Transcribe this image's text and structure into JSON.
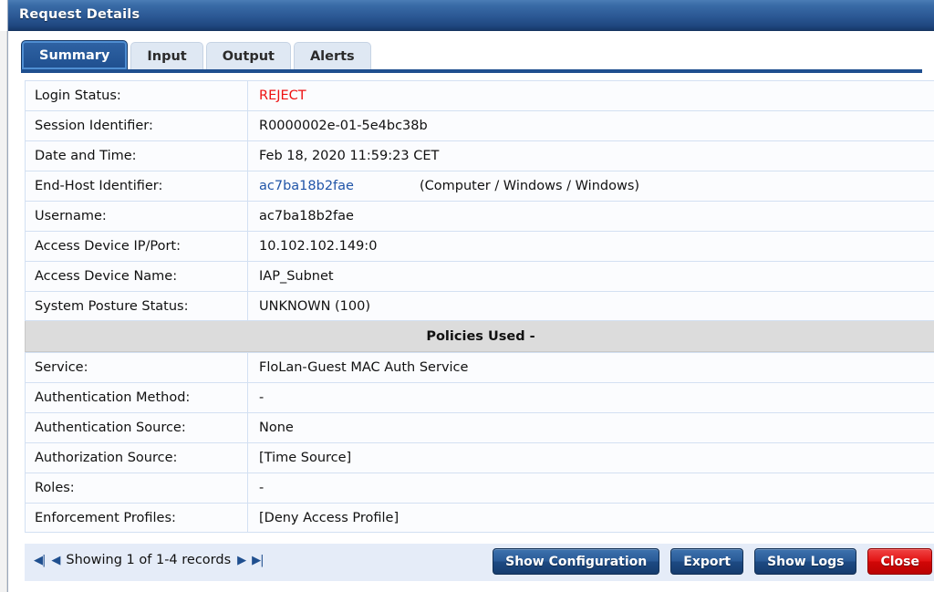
{
  "window": {
    "title": "Request Details"
  },
  "tabs": [
    {
      "label": "Summary",
      "active": true
    },
    {
      "label": "Input",
      "active": false
    },
    {
      "label": "Output",
      "active": false
    },
    {
      "label": "Alerts",
      "active": false
    }
  ],
  "summary_rows": [
    {
      "label": "Login Status:",
      "value": "REJECT",
      "style": "reject"
    },
    {
      "label": "Session Identifier:",
      "value": "R0000002e-01-5e4bc38b",
      "style": "plain"
    },
    {
      "label": "Date and Time:",
      "value": "Feb 18, 2020 11:59:23 CET",
      "style": "plain"
    },
    {
      "label": "End-Host Identifier:",
      "value": "ac7ba18b2fae",
      "extra": "(Computer / Windows / Windows)",
      "style": "link"
    },
    {
      "label": "Username:",
      "value": "ac7ba18b2fae",
      "style": "plain"
    },
    {
      "label": "Access Device IP/Port:",
      "value": "10.102.102.149:0",
      "style": "plain"
    },
    {
      "label": "Access Device Name:",
      "value": "IAP_Subnet",
      "style": "plain"
    },
    {
      "label": "System Posture Status:",
      "value": "UNKNOWN (100)",
      "style": "plain"
    }
  ],
  "policies_section": {
    "header": "Policies Used -",
    "rows": [
      {
        "label": "Service:",
        "value": "FloLan-Guest MAC Auth Service"
      },
      {
        "label": "Authentication Method:",
        "value": "-"
      },
      {
        "label": "Authentication Source:",
        "value": "None"
      },
      {
        "label": "Authorization Source:",
        "value": "[Time Source]"
      },
      {
        "label": "Roles:",
        "value": "-"
      },
      {
        "label": "Enforcement Profiles:",
        "value": "[Deny Access Profile]"
      }
    ]
  },
  "footer": {
    "pager": {
      "first_icon": "◀|",
      "prev_icon": "◀",
      "text": "Showing 1 of 1-4 records",
      "next_icon": "▶",
      "last_icon": "▶|"
    },
    "buttons": [
      {
        "label": "Show Configuration",
        "kind": "primary"
      },
      {
        "label": "Export",
        "kind": "primary"
      },
      {
        "label": "Show Logs",
        "kind": "primary"
      },
      {
        "label": "Close",
        "kind": "danger"
      }
    ]
  },
  "colors": {
    "titlebar": "#1f4780",
    "tab_active": "#1f4f8f",
    "reject_red": "#ee1111",
    "link_blue": "#2155a8",
    "section_gray": "#dcdcdc",
    "footer_blue": "#e5ecf8",
    "close_red": "#e31414"
  }
}
